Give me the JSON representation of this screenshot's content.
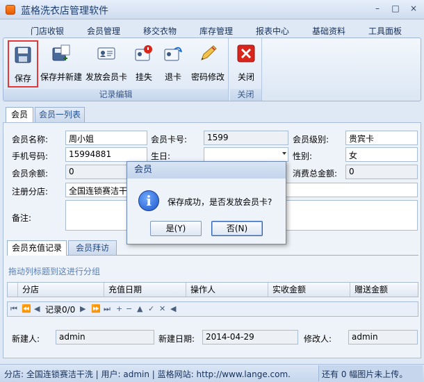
{
  "window": {
    "title": "蓝格洗衣店管理软件",
    "controls": {
      "minimize": "–",
      "restore": "□",
      "close": "×"
    }
  },
  "menu": [
    "门店收银",
    "会员管理",
    "移交衣物",
    "库存管理",
    "报表中心",
    "基础资料",
    "工具面板"
  ],
  "ribbon": {
    "group_edit_label": "记录编辑",
    "group_close_label": "关闭",
    "buttons": [
      {
        "label": "保存",
        "icon": "save-icon"
      },
      {
        "label": "保存并新建",
        "icon": "save-new-icon"
      },
      {
        "label": "发放会员卡",
        "icon": "issue-card-icon"
      },
      {
        "label": "挂失",
        "icon": "report-loss-icon"
      },
      {
        "label": "退卡",
        "icon": "return-card-icon"
      },
      {
        "label": "密码修改",
        "icon": "change-password-icon"
      },
      {
        "label": "关闭",
        "icon": "close-icon"
      }
    ]
  },
  "tabs": {
    "member": "会员",
    "member_list": "会员一列表"
  },
  "form": {
    "name_label": "会员名称:",
    "name_value": "周小姐",
    "card_no_label": "会员卡号:",
    "card_no_value": "1599",
    "level_label": "会员级别:",
    "level_value": "贵宾卡",
    "phone_label": "手机号码:",
    "phone_value": "15994881",
    "birthday_label": "生日:",
    "birthday_value": "",
    "gender_label": "性别:",
    "gender_value": "女",
    "balance_label": "会员余额:",
    "balance_value": "0",
    "total_spent_label": "消费总金额:",
    "total_spent_value": "0",
    "branch_label": "注册分店:",
    "branch_value": "全国连锁赛洁干洗",
    "remark_label": "备注:",
    "remark_value": ""
  },
  "subtabs": {
    "recharge": "会员充值记录",
    "visit": "会员拜访"
  },
  "grid": {
    "group_hint": "拖动列标题到这进行分组",
    "columns": [
      "分店",
      "充值日期",
      "操作人",
      "实收金额",
      "赠送金额"
    ],
    "nav_record": "记录0/0"
  },
  "footer": {
    "creator_label": "新建人:",
    "creator_value": "admin",
    "created_date_label": "新建日期:",
    "created_date_value": "2014-04-29",
    "modifier_label": "修改人:",
    "modifier_value": "admin"
  },
  "dialog": {
    "title": "会员",
    "message": "保存成功，是否发放会员卡?",
    "yes": "是(Y)",
    "no": "否(N)"
  },
  "status": {
    "left": "分店: 全国连锁赛洁干洗 | 用户: admin | 蓝格网站: http://www.lange.com.",
    "right": "还有 0 幅图片未上传。"
  },
  "colors": {
    "accent": "#1d3f72",
    "highlight_border": "#e23838",
    "close_red": "#d9261c"
  }
}
